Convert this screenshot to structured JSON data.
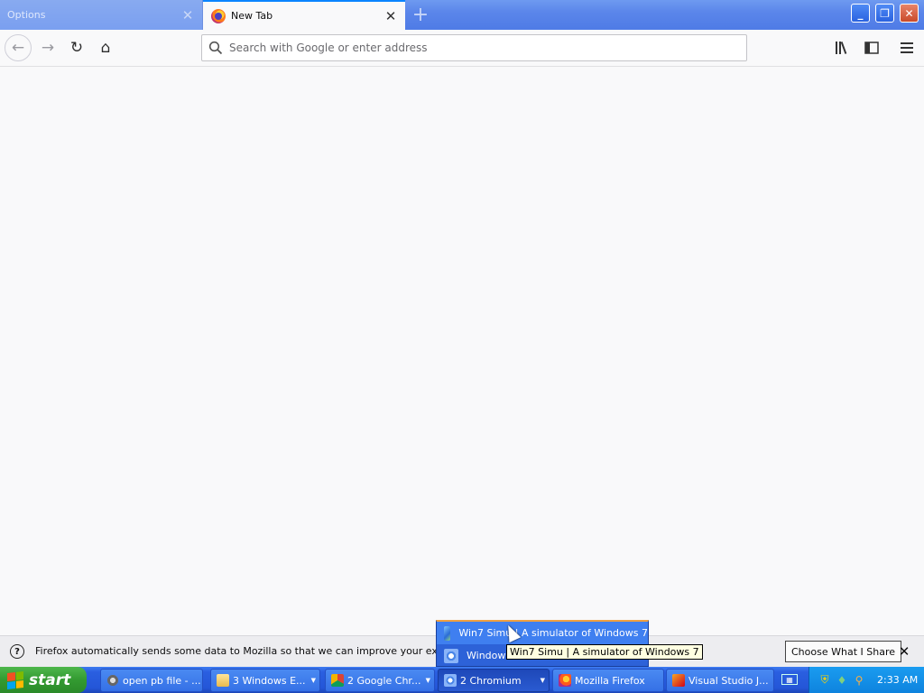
{
  "browser": {
    "tabs": [
      {
        "label": "Options",
        "active": false
      },
      {
        "label": "New Tab",
        "active": true
      }
    ],
    "new_tab_symbol": "+",
    "window_controls": {
      "minimize": "minimize-icon",
      "maximize": "maximize-icon",
      "close": "close-icon"
    }
  },
  "navbar": {
    "back_icon": "back-arrow-icon",
    "forward_icon": "forward-arrow-icon",
    "reload_icon": "reload-icon",
    "home_icon": "home-icon",
    "address_placeholder": "Search with Google or enter address",
    "library_icon": "library-icon",
    "sidebar_icon": "sidebar-icon",
    "menu_icon": "hamburger-menu-icon"
  },
  "notification": {
    "message": "Firefox automatically sends some data to Mozilla so that we can improve your experience.",
    "button": "Choose What I Share"
  },
  "taskbar": {
    "start_label": "start",
    "buttons": [
      {
        "label": "open pb file - ...",
        "icon": "gear-icon",
        "grouped": false
      },
      {
        "label": "3 Windows E...",
        "icon": "folder-icon",
        "grouped": true
      },
      {
        "label": "2 Google Chr...",
        "icon": "chrome-icon",
        "grouped": true
      },
      {
        "label": "2 Chromium",
        "icon": "chromium-icon",
        "grouped": true
      },
      {
        "label": "Mozilla Firefox",
        "icon": "firefox-icon",
        "grouped": false
      },
      {
        "label": "Visual Studio J...",
        "icon": "visual-studio-icon",
        "grouped": false
      }
    ],
    "clock": "2:33 AM"
  },
  "popup": {
    "items": [
      {
        "label": "Win7 Simu | A simulator of Windows 7",
        "highlighted": true
      },
      {
        "label": "Windows",
        "highlighted": false
      }
    ],
    "tooltip": "Win7 Simu | A simulator of Windows 7"
  },
  "colors": {
    "accent": "#0a84ff",
    "xp_taskbar": "#2456d8",
    "start_green": "#339a31"
  }
}
